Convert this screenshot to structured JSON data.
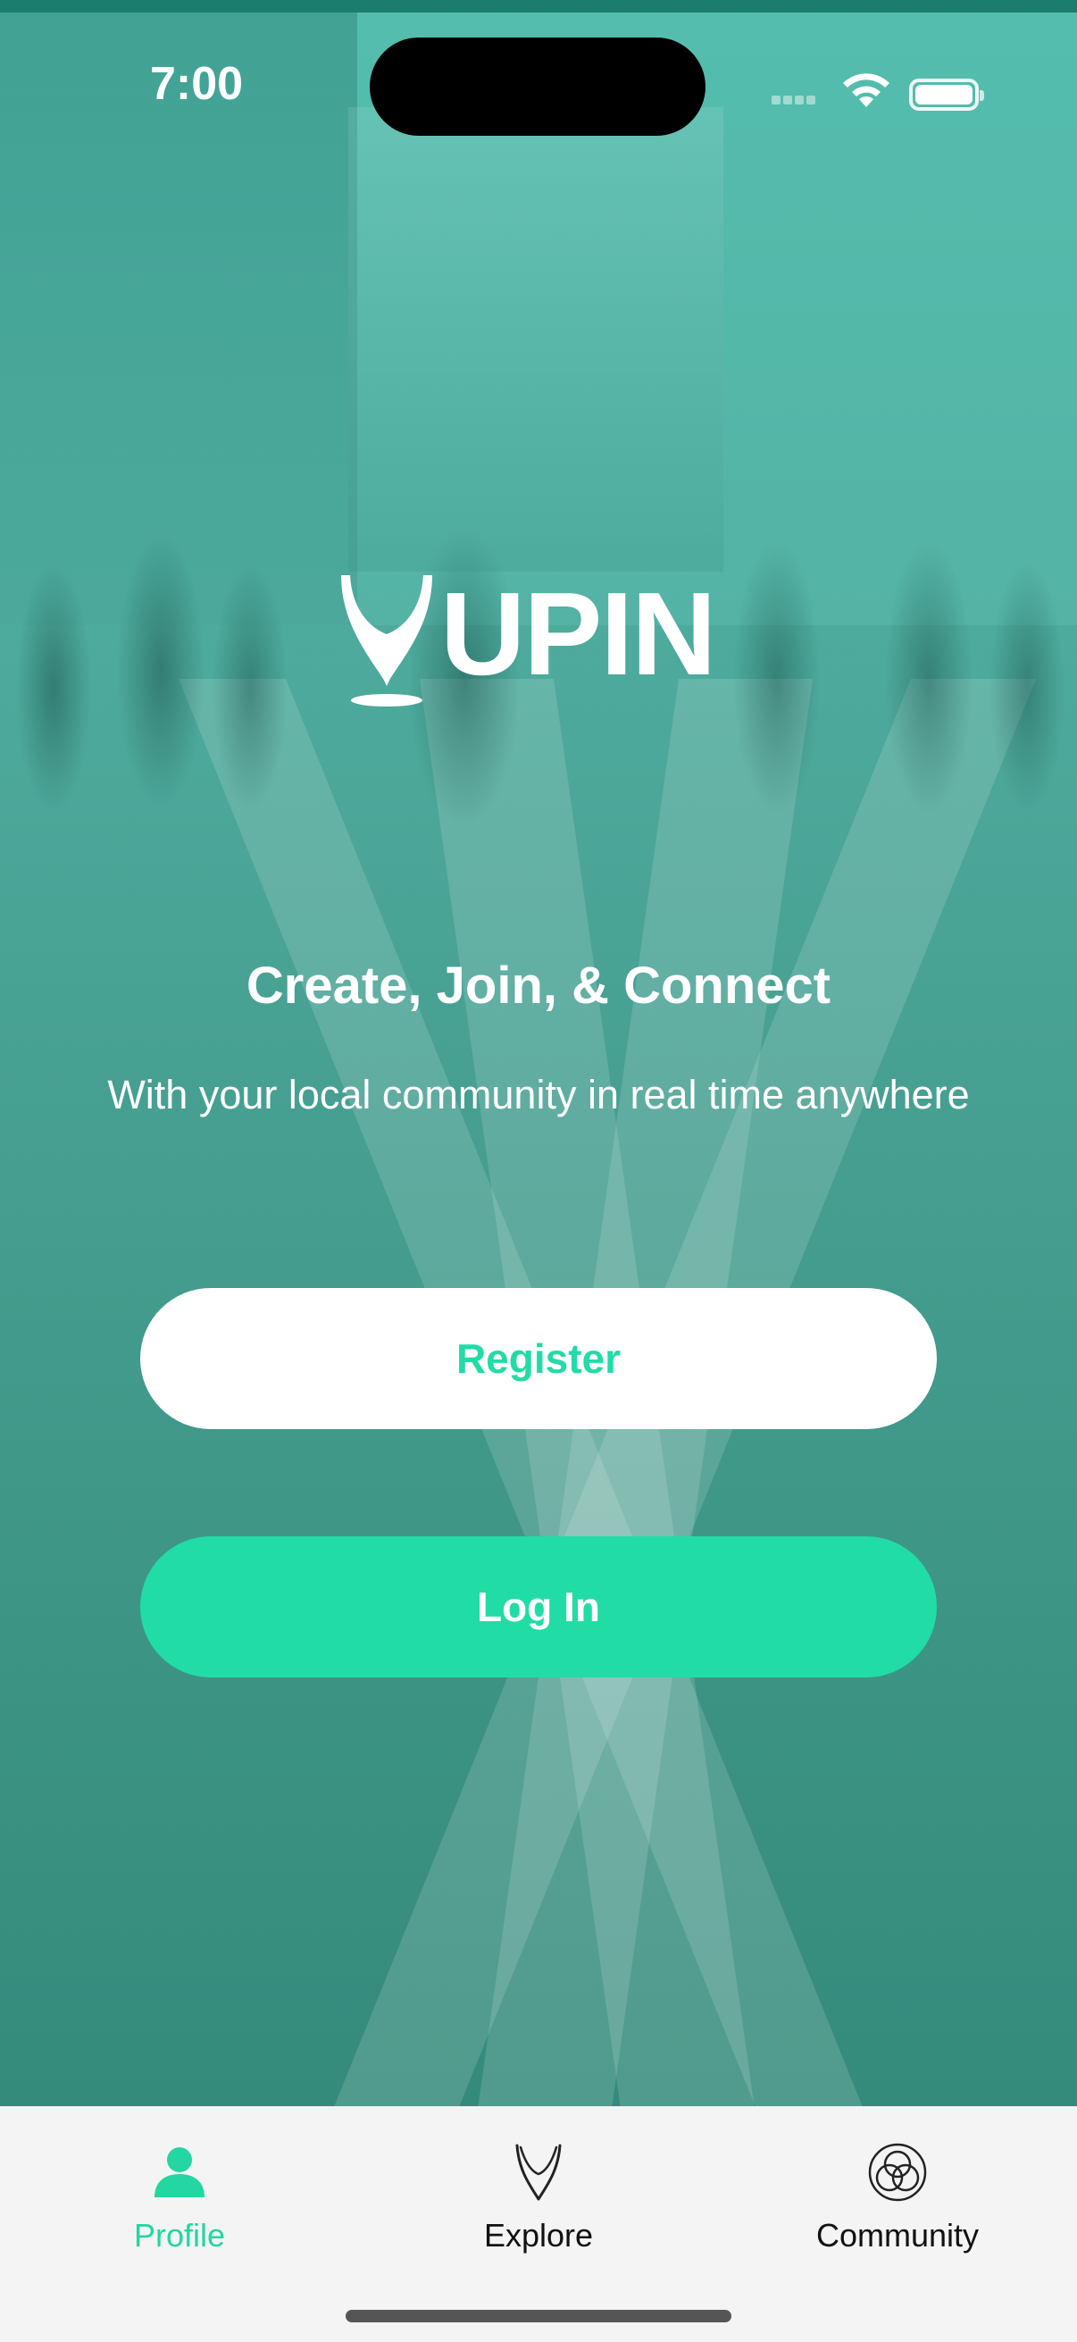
{
  "status_bar": {
    "time": "7:00"
  },
  "brand": {
    "name": "UPIN"
  },
  "hero": {
    "headline": "Create, Join, & Connect",
    "subheadline": "With your local community in real time anywhere"
  },
  "actions": {
    "register_label": "Register",
    "login_label": "Log In"
  },
  "tab_bar": {
    "items": [
      {
        "label": "Profile",
        "icon": "person-icon",
        "active": true
      },
      {
        "label": "Explore",
        "icon": "pin-outline-icon",
        "active": false
      },
      {
        "label": "Community",
        "icon": "interlocking-circles-icon",
        "active": false
      }
    ]
  },
  "colors": {
    "accent": "#22dca6",
    "overlay": "#2fa08f",
    "tab_bar_bg": "#f4f4f4"
  }
}
